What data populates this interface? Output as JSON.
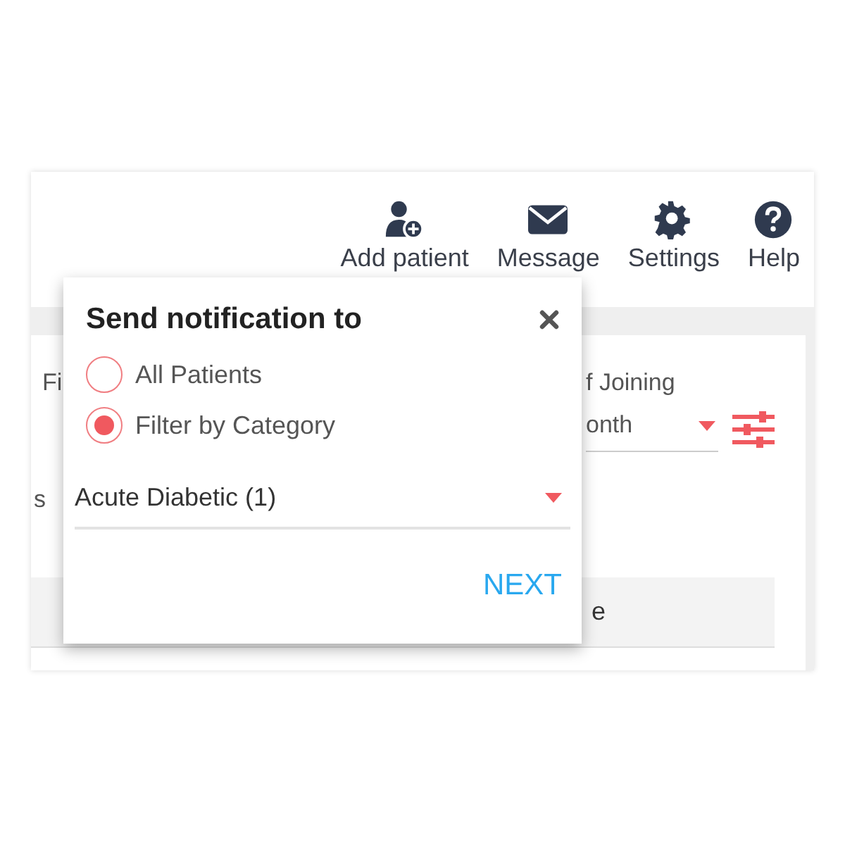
{
  "toolbar": [
    {
      "label": "Add patient",
      "kind": "add-person"
    },
    {
      "label": "Message",
      "kind": "envelope"
    },
    {
      "label": "Settings",
      "kind": "gear"
    },
    {
      "label": "Help",
      "kind": "help"
    }
  ],
  "background": {
    "filter_label": "Fi",
    "joining_label": "f Joining",
    "period_value": "onth",
    "hint": "s",
    "table_header": "e"
  },
  "dialog": {
    "title": "Send notification to",
    "options": [
      {
        "label": "All Patients",
        "selected": false
      },
      {
        "label": "Filter by Category",
        "selected": true
      }
    ],
    "category": {
      "value": "Acute Diabetic (1)"
    },
    "next": "NEXT"
  }
}
